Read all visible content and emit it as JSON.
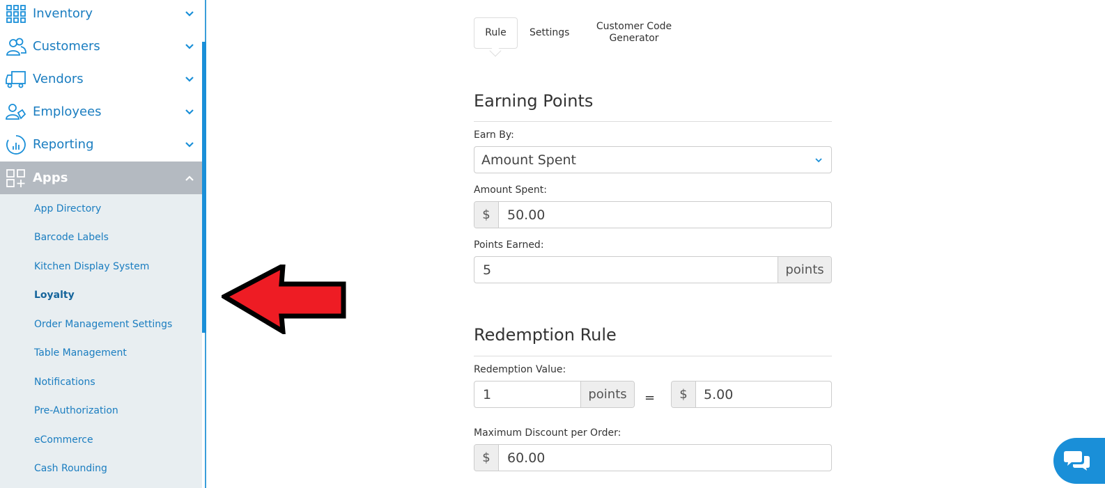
{
  "sidebar": {
    "items": [
      {
        "label": "Inventory",
        "icon": "grid-icon"
      },
      {
        "label": "Customers",
        "icon": "customers-icon"
      },
      {
        "label": "Vendors",
        "icon": "truck-icon"
      },
      {
        "label": "Employees",
        "icon": "employees-icon"
      },
      {
        "label": "Reporting",
        "icon": "chart-icon"
      },
      {
        "label": "Apps",
        "icon": "apps-icon"
      }
    ],
    "apps_submenu": [
      "App Directory",
      "Barcode Labels",
      "Kitchen Display System",
      "Loyalty",
      "Order Management Settings",
      "Table Management",
      "Notifications",
      "Pre-Authorization",
      "eCommerce",
      "Cash Rounding"
    ]
  },
  "tabs": {
    "rule": "Rule",
    "settings": "Settings",
    "generator_line1": "Customer Code",
    "generator_line2": "Generator"
  },
  "earning": {
    "title": "Earning Points",
    "earn_by_label": "Earn By:",
    "earn_by_value": "Amount Spent",
    "amount_label": "Amount Spent:",
    "currency": "$",
    "amount_value": "50.00",
    "points_label": "Points Earned:",
    "points_value": "5",
    "points_unit": "points"
  },
  "redemption": {
    "title": "Redemption Rule",
    "value_label": "Redemption Value:",
    "points_value": "1",
    "points_unit": "points",
    "equals": "=",
    "currency": "$",
    "dollar_value": "5.00",
    "max_label": "Maximum Discount per Order:",
    "max_currency": "$",
    "max_value": "60.00"
  },
  "colors": {
    "accent": "#1a8fd8",
    "active_bg": "#b4bac1",
    "submenu_bg": "#e8eef1",
    "arrow": "#ee1c24"
  }
}
